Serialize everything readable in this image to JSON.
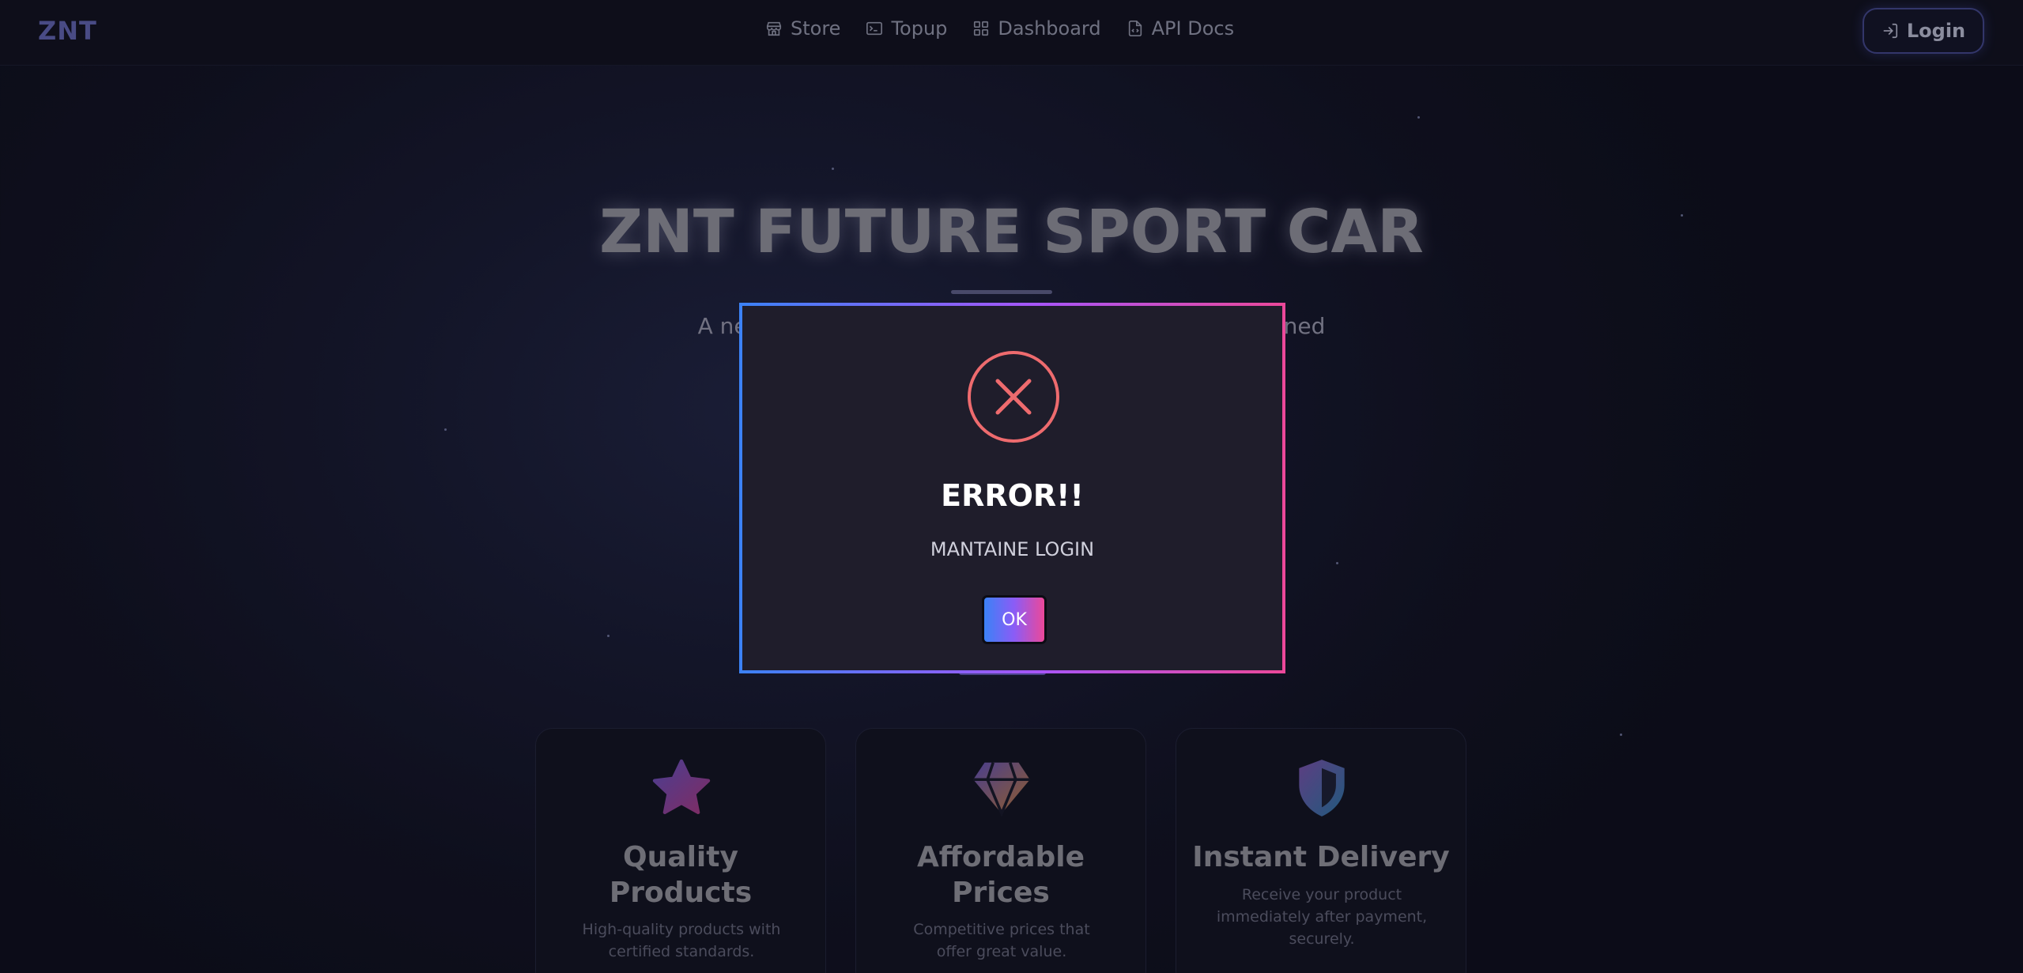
{
  "nav": {
    "logo": "ZNT",
    "links": [
      {
        "label": "Store",
        "icon": "store-icon"
      },
      {
        "label": "Topup",
        "icon": "terminal-icon"
      },
      {
        "label": "Dashboard",
        "icon": "dashboard-grid-icon"
      },
      {
        "label": "API Docs",
        "icon": "file-code-icon"
      }
    ],
    "login_label": "Login"
  },
  "hero": {
    "title": "ZNT FUTURE SPORT CAR",
    "subtitle_left": "A ne",
    "subtitle_right": "ned"
  },
  "features": [
    {
      "title_line1": "Quality",
      "title_line2": "Products",
      "desc": "High-quality products with certified standards.",
      "icon": "star-icon"
    },
    {
      "title_line1": "Affordable",
      "title_line2": "Prices",
      "desc": "Competitive prices that offer great value.",
      "icon": "diamond-icon"
    },
    {
      "title_line1": "Instant Delivery",
      "title_line2": "",
      "desc": "Receive your product immediately after payment, securely.",
      "icon": "shield-icon"
    }
  ],
  "modal": {
    "title": "ERROR!!",
    "message": "MANTAINE LOGIN",
    "ok_label": "OK",
    "icon": "error-x-icon"
  },
  "colors": {
    "accent_blue": "#3b82f6",
    "accent_purple": "#8b5cf6",
    "accent_pink": "#ec4899",
    "error_red": "#ee6b6e",
    "background": "#121324"
  }
}
